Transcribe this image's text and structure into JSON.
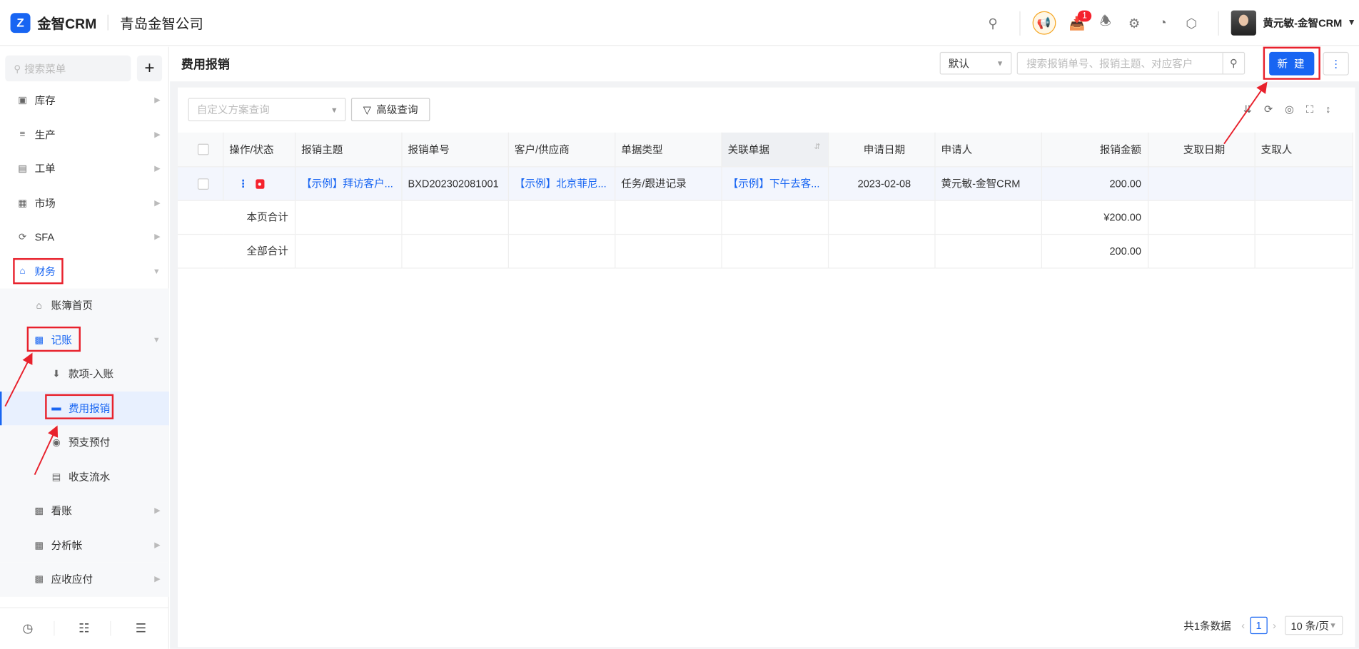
{
  "app": {
    "name": "金智CRM",
    "company": "青岛金智公司"
  },
  "topbar": {
    "notify_count": "1",
    "username": "黄元敏-金智CRM"
  },
  "sidebar": {
    "search_placeholder": "搜索菜单",
    "items": [
      {
        "label": "库存",
        "icon": "building-icon"
      },
      {
        "label": "生产",
        "icon": "production-icon"
      },
      {
        "label": "工单",
        "icon": "workorder-icon"
      },
      {
        "label": "市场",
        "icon": "market-icon"
      },
      {
        "label": "SFA",
        "icon": "sfa-icon"
      },
      {
        "label": "财务",
        "icon": "home-icon"
      },
      {
        "label": "账簿首页",
        "icon": "home-icon"
      },
      {
        "label": "记账",
        "icon": "folder-icon"
      },
      {
        "label": "款项-入账",
        "icon": "download-icon"
      },
      {
        "label": "费用报销",
        "icon": "card-icon"
      },
      {
        "label": "预支预付",
        "icon": "prepay-icon"
      },
      {
        "label": "收支流水",
        "icon": "ledger-icon"
      },
      {
        "label": "看账",
        "icon": "folder-icon"
      },
      {
        "label": "分析帐",
        "icon": "folder-icon"
      },
      {
        "label": "应收应付",
        "icon": "folder-icon"
      }
    ]
  },
  "header": {
    "title": "费用报销",
    "view_select": "默认",
    "search_placeholder": "搜索报销单号、报销主题、对应客户",
    "new_label": "新 建"
  },
  "filter": {
    "scheme_placeholder": "自定义方案查询",
    "advanced_label": "高级查询"
  },
  "table": {
    "columns": [
      "操作/状态",
      "报销主题",
      "报销单号",
      "客户/供应商",
      "单据类型",
      "关联单据",
      "申请日期",
      "申请人",
      "报销金额",
      "支取日期",
      "支取人"
    ],
    "row": {
      "subject": "【示例】拜访客户...",
      "number": "BXD202302081001",
      "customer": "【示例】北京菲尼...",
      "type": "任务/跟进记录",
      "related": "【示例】下午去客...",
      "date": "2023-02-08",
      "applicant": "黄元敏-金智CRM",
      "amount": "200.00"
    },
    "page_total_label": "本页合计",
    "page_total_amount": "¥200.00",
    "all_total_label": "全部合计",
    "all_total_amount": "200.00"
  },
  "pager": {
    "summary": "共1条数据",
    "page": "1",
    "size": "10 条/页"
  },
  "colors": {
    "accent": "#1865f2",
    "annotation": "#e8212c"
  }
}
